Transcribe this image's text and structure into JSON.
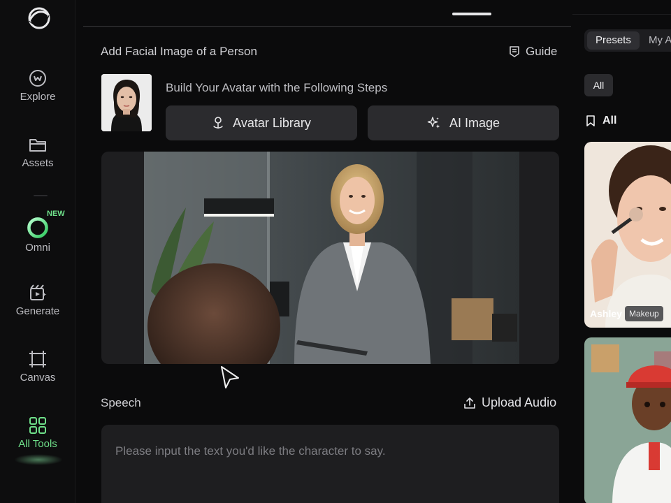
{
  "sidebar": {
    "items": [
      {
        "label": "Explore",
        "icon": "explore-icon"
      },
      {
        "label": "Assets",
        "icon": "folder-icon"
      },
      {
        "label": "Omni",
        "icon": "omni-ring-icon",
        "badge": "NEW"
      },
      {
        "label": "Generate",
        "icon": "generate-icon"
      },
      {
        "label": "Canvas",
        "icon": "canvas-icon"
      },
      {
        "label": "All Tools",
        "icon": "grid-icon",
        "active": true
      }
    ]
  },
  "main": {
    "facial_section_title": "Add Facial Image of a Person",
    "guide_label": "Guide",
    "steps_title": "Build Your Avatar with the Following Steps",
    "avatar_library_label": "Avatar Library",
    "ai_image_label": "AI Image",
    "speech_title": "Speech",
    "upload_audio_label": "Upload Audio",
    "speech_placeholder": "Please input the text you'd like the character to say."
  },
  "right_panel": {
    "tabs": [
      {
        "label": "Presets",
        "active": true
      },
      {
        "label": "My A"
      }
    ],
    "filter_chip": "All",
    "category_title": "All",
    "cards": [
      {
        "name": "Ashley",
        "tag": "Makeup"
      },
      {
        "name": "",
        "tag": ""
      }
    ]
  },
  "colors": {
    "accent_green": "#6fe08a",
    "background": "#0b0b0c",
    "panel": "#1e1e20",
    "button": "#2b2b2e"
  }
}
